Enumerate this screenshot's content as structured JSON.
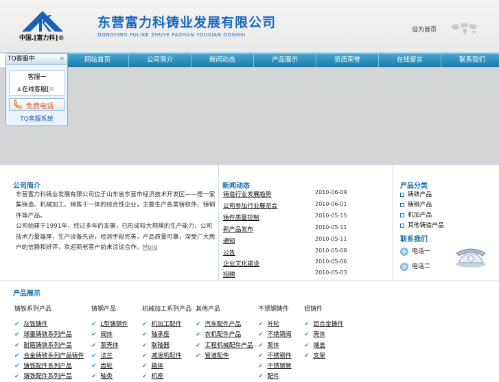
{
  "header": {
    "logo_caption": "中国.[富力科]®",
    "company_name": "东营富力科铸业发展有限公司",
    "company_pinyin": "DONGYING FULIKE ZHUYE FAZHAN YOUXIAN GONGSI",
    "link": "设为首页"
  },
  "nav": {
    "items": [
      "网站首页",
      "公司简介",
      "新闻动态",
      "产品展示",
      "资质荣誉",
      "在线留言",
      "联系我们"
    ]
  },
  "tq": {
    "title": "TQ客服中",
    "close": "×",
    "contact_name": "客服一",
    "contact_line": "在线客服[",
    "free_call": "免费电话",
    "footer": "TQ客服系统"
  },
  "about": {
    "title": "公司简介",
    "paragraphs": [
      "东营富力科铸业发展有限公司位于山东省东营市经济技术开发区——是一家集铸造、机械加工、销售于一体的综合性企业，主要生产各类铸铁件、铸钢件等产品。",
      "公司始建于1991年，经过多年的发展，已形成较大规模的生产能力，公司技术力量雄厚，生产设备先进，检测手段完善，产品质量可靠，深受广大用户的信赖和好评，欢迎新老客户前来洽谈合作。"
    ],
    "more": "More"
  },
  "news": {
    "title": "新闻动态",
    "items": [
      {
        "title": "铸造行业发展趋势",
        "date": "2010-06-09"
      },
      {
        "title": "公司参加行业展览会",
        "date": "2010-06-01"
      },
      {
        "title": "铸件质量控制",
        "date": "2010-05-15"
      },
      {
        "title": "新产品发布",
        "date": "2010-05-11"
      },
      {
        "title": "通知",
        "date": "2010-05-11"
      },
      {
        "title": "公告",
        "date": "2010-05-08"
      },
      {
        "title": "企业文化建设",
        "date": "2010-05-06"
      },
      {
        "title": "招聘",
        "date": "2010-05-03"
      }
    ]
  },
  "products_side": {
    "title": "产品分类",
    "items": [
      "铸铁产品",
      "铸钢产品",
      "机加产品",
      "其他铸造产品"
    ]
  },
  "contact": {
    "title": "联系我们",
    "items": [
      "电话一",
      "电话二"
    ]
  },
  "products": {
    "title": "产品展示",
    "columns": [
      {
        "header": "铸铁系列产品",
        "items": [
          "灰铁铸件",
          "球墨铸铁系列产品",
          "耐磨铸铁系列产品",
          "合金铸铁系列产品铸件",
          "铸铁配件系列产品",
          "铸铁配件系列产品"
        ]
      },
      {
        "header": "铸钢产品",
        "items": [
          "L型铸钢件",
          "阀体",
          "泵壳体",
          "法兰",
          "齿轮",
          "轴类"
        ]
      },
      {
        "header": "机械加工系列产品",
        "items": [
          "机加工配件",
          "轴承座",
          "联轴器",
          "减速机配件",
          "箱体",
          "机座"
        ]
      },
      {
        "header": "其他产品",
        "items": [
          "汽车配件产品",
          "农机配件产品",
          "工程机械配件产品",
          "管道配件"
        ]
      },
      {
        "header": "不锈钢铸件",
        "items": [
          "叶轮",
          "不锈钢阀",
          "泵体",
          "不锈钢件",
          "不锈钢管",
          "配件"
        ]
      },
      {
        "header": "铝铸件",
        "items": [
          "铝合金铸件",
          "壳体",
          "端盖",
          "支架"
        ]
      }
    ]
  },
  "colors": {
    "accent": "#1c6ea8",
    "nav_bg": "#1a79a8",
    "brand": "#1868c0"
  }
}
